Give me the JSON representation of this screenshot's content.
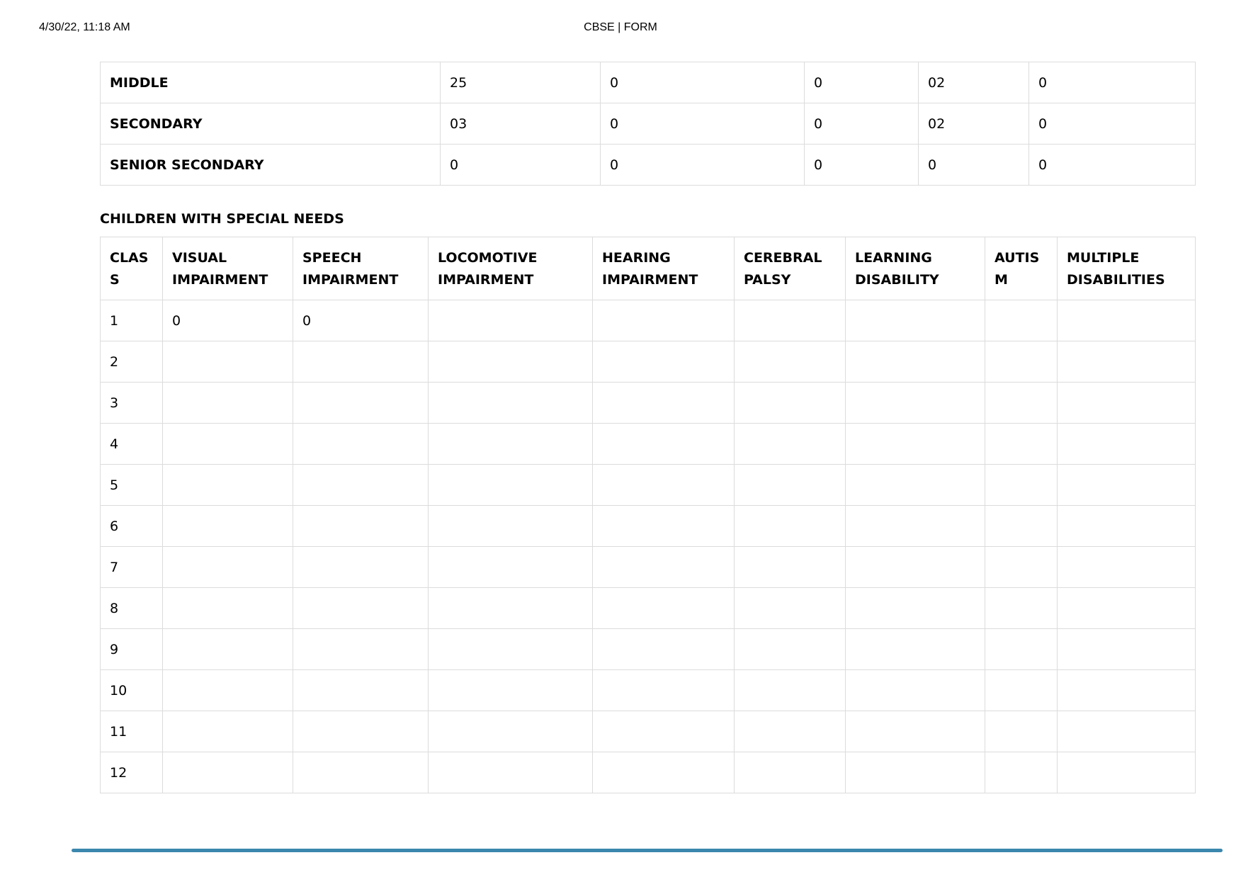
{
  "print_header": {
    "timestamp": "4/30/22, 11:18 AM",
    "title": "CBSE | FORM"
  },
  "summary_table": {
    "rows": [
      {
        "label": "MIDDLE",
        "values": [
          "25",
          "0",
          "0",
          "02",
          "0"
        ]
      },
      {
        "label": "SECONDARY",
        "values": [
          "03",
          "0",
          "0",
          "02",
          "0"
        ]
      },
      {
        "label": "SENIOR SECONDARY",
        "values": [
          "0",
          "0",
          "0",
          "0",
          "0"
        ]
      }
    ]
  },
  "cwsn": {
    "heading": "CHILDREN WITH SPECIAL NEEDS",
    "columns": [
      "CLASS",
      "VISUAL IMPAIRMENT",
      "SPEECH IMPAIRMENT",
      "LOCOMOTIVE IMPAIRMENT",
      "HEARING IMPAIRMENT",
      "CEREBRAL PALSY",
      "LEARNING DISABILITY",
      "AUTISM",
      "MULTIPLE DISABILITIES"
    ],
    "rows": [
      [
        "1",
        "0",
        "0",
        "",
        "",
        "",
        "",
        "",
        ""
      ],
      [
        "2",
        "",
        "",
        "",
        "",
        "",
        "",
        "",
        ""
      ],
      [
        "3",
        "",
        "",
        "",
        "",
        "",
        "",
        "",
        ""
      ],
      [
        "4",
        "",
        "",
        "",
        "",
        "",
        "",
        "",
        ""
      ],
      [
        "5",
        "",
        "",
        "",
        "",
        "",
        "",
        "",
        ""
      ],
      [
        "6",
        "",
        "",
        "",
        "",
        "",
        "",
        "",
        ""
      ],
      [
        "7",
        "",
        "",
        "",
        "",
        "",
        "",
        "",
        ""
      ],
      [
        "8",
        "",
        "",
        "",
        "",
        "",
        "",
        "",
        ""
      ],
      [
        "9",
        "",
        "",
        "",
        "",
        "",
        "",
        "",
        ""
      ],
      [
        "10",
        "",
        "",
        "",
        "",
        "",
        "",
        "",
        ""
      ],
      [
        "11",
        "",
        "",
        "",
        "",
        "",
        "",
        "",
        ""
      ],
      [
        "12",
        "",
        "",
        "",
        "",
        "",
        "",
        "",
        ""
      ]
    ]
  },
  "colors": {
    "border": "#dcdcdc",
    "accent_rule": "#3b87ad"
  }
}
